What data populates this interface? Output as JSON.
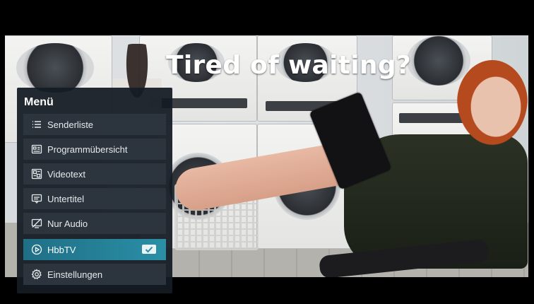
{
  "video": {
    "headline": "Tired of waiting?"
  },
  "menu": {
    "title": "Menü",
    "items": [
      {
        "label": "Senderliste",
        "icon": "list-icon"
      },
      {
        "label": "Programmübersicht",
        "icon": "program-guide-icon"
      },
      {
        "label": "Videotext",
        "icon": "teletext-icon"
      },
      {
        "label": "Untertitel",
        "icon": "subtitles-icon"
      },
      {
        "label": "Nur Audio",
        "icon": "audio-only-icon"
      },
      {
        "label": "HbbTV",
        "icon": "play-circle-icon",
        "selected": true,
        "checked": true
      },
      {
        "label": "Einstellungen",
        "icon": "gear-icon"
      }
    ],
    "accent_color": "#2a8fa6"
  }
}
